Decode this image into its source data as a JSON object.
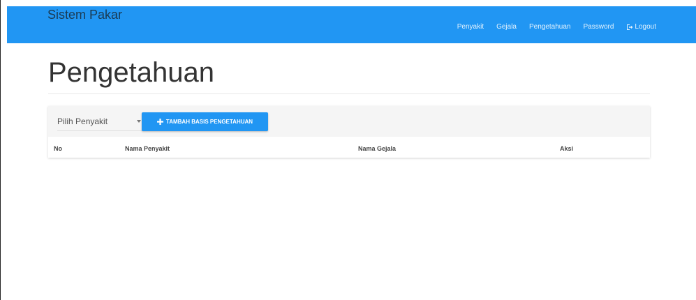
{
  "navbar": {
    "brand": "Sistem Pakar",
    "items": [
      {
        "label": "Penyakit"
      },
      {
        "label": "Gejala"
      },
      {
        "label": "Pengetahuan"
      },
      {
        "label": "Password"
      }
    ],
    "logout_label": "Logout",
    "bg_color": "#2196f3"
  },
  "page": {
    "title": "Pengetahuan"
  },
  "toolbar": {
    "select_value": "Pilih Penyakit",
    "add_button_label": "TAMBAH BASIS PENGETAHUAN"
  },
  "table": {
    "columns": [
      "No",
      "Nama Penyakit",
      "Nama Gejala",
      "Aksi"
    ],
    "rows": []
  },
  "icons": {
    "logout": "logout-icon",
    "add": "plus-icon",
    "select_caret": "caret-down-icon"
  }
}
